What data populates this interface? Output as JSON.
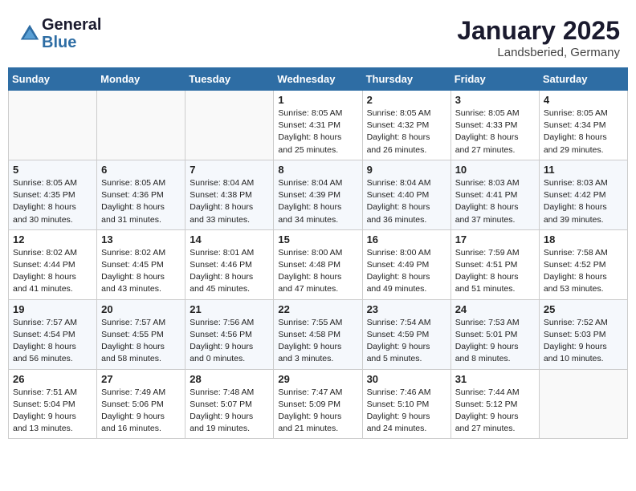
{
  "header": {
    "logo_line1": "General",
    "logo_line2": "Blue",
    "month_title": "January 2025",
    "location": "Landsberied, Germany"
  },
  "weekdays": [
    "Sunday",
    "Monday",
    "Tuesday",
    "Wednesday",
    "Thursday",
    "Friday",
    "Saturday"
  ],
  "weeks": [
    [
      {
        "day": "",
        "info": ""
      },
      {
        "day": "",
        "info": ""
      },
      {
        "day": "",
        "info": ""
      },
      {
        "day": "1",
        "info": "Sunrise: 8:05 AM\nSunset: 4:31 PM\nDaylight: 8 hours\nand 25 minutes."
      },
      {
        "day": "2",
        "info": "Sunrise: 8:05 AM\nSunset: 4:32 PM\nDaylight: 8 hours\nand 26 minutes."
      },
      {
        "day": "3",
        "info": "Sunrise: 8:05 AM\nSunset: 4:33 PM\nDaylight: 8 hours\nand 27 minutes."
      },
      {
        "day": "4",
        "info": "Sunrise: 8:05 AM\nSunset: 4:34 PM\nDaylight: 8 hours\nand 29 minutes."
      }
    ],
    [
      {
        "day": "5",
        "info": "Sunrise: 8:05 AM\nSunset: 4:35 PM\nDaylight: 8 hours\nand 30 minutes."
      },
      {
        "day": "6",
        "info": "Sunrise: 8:05 AM\nSunset: 4:36 PM\nDaylight: 8 hours\nand 31 minutes."
      },
      {
        "day": "7",
        "info": "Sunrise: 8:04 AM\nSunset: 4:38 PM\nDaylight: 8 hours\nand 33 minutes."
      },
      {
        "day": "8",
        "info": "Sunrise: 8:04 AM\nSunset: 4:39 PM\nDaylight: 8 hours\nand 34 minutes."
      },
      {
        "day": "9",
        "info": "Sunrise: 8:04 AM\nSunset: 4:40 PM\nDaylight: 8 hours\nand 36 minutes."
      },
      {
        "day": "10",
        "info": "Sunrise: 8:03 AM\nSunset: 4:41 PM\nDaylight: 8 hours\nand 37 minutes."
      },
      {
        "day": "11",
        "info": "Sunrise: 8:03 AM\nSunset: 4:42 PM\nDaylight: 8 hours\nand 39 minutes."
      }
    ],
    [
      {
        "day": "12",
        "info": "Sunrise: 8:02 AM\nSunset: 4:44 PM\nDaylight: 8 hours\nand 41 minutes."
      },
      {
        "day": "13",
        "info": "Sunrise: 8:02 AM\nSunset: 4:45 PM\nDaylight: 8 hours\nand 43 minutes."
      },
      {
        "day": "14",
        "info": "Sunrise: 8:01 AM\nSunset: 4:46 PM\nDaylight: 8 hours\nand 45 minutes."
      },
      {
        "day": "15",
        "info": "Sunrise: 8:00 AM\nSunset: 4:48 PM\nDaylight: 8 hours\nand 47 minutes."
      },
      {
        "day": "16",
        "info": "Sunrise: 8:00 AM\nSunset: 4:49 PM\nDaylight: 8 hours\nand 49 minutes."
      },
      {
        "day": "17",
        "info": "Sunrise: 7:59 AM\nSunset: 4:51 PM\nDaylight: 8 hours\nand 51 minutes."
      },
      {
        "day": "18",
        "info": "Sunrise: 7:58 AM\nSunset: 4:52 PM\nDaylight: 8 hours\nand 53 minutes."
      }
    ],
    [
      {
        "day": "19",
        "info": "Sunrise: 7:57 AM\nSunset: 4:54 PM\nDaylight: 8 hours\nand 56 minutes."
      },
      {
        "day": "20",
        "info": "Sunrise: 7:57 AM\nSunset: 4:55 PM\nDaylight: 8 hours\nand 58 minutes."
      },
      {
        "day": "21",
        "info": "Sunrise: 7:56 AM\nSunset: 4:56 PM\nDaylight: 9 hours\nand 0 minutes."
      },
      {
        "day": "22",
        "info": "Sunrise: 7:55 AM\nSunset: 4:58 PM\nDaylight: 9 hours\nand 3 minutes."
      },
      {
        "day": "23",
        "info": "Sunrise: 7:54 AM\nSunset: 4:59 PM\nDaylight: 9 hours\nand 5 minutes."
      },
      {
        "day": "24",
        "info": "Sunrise: 7:53 AM\nSunset: 5:01 PM\nDaylight: 9 hours\nand 8 minutes."
      },
      {
        "day": "25",
        "info": "Sunrise: 7:52 AM\nSunset: 5:03 PM\nDaylight: 9 hours\nand 10 minutes."
      }
    ],
    [
      {
        "day": "26",
        "info": "Sunrise: 7:51 AM\nSunset: 5:04 PM\nDaylight: 9 hours\nand 13 minutes."
      },
      {
        "day": "27",
        "info": "Sunrise: 7:49 AM\nSunset: 5:06 PM\nDaylight: 9 hours\nand 16 minutes."
      },
      {
        "day": "28",
        "info": "Sunrise: 7:48 AM\nSunset: 5:07 PM\nDaylight: 9 hours\nand 19 minutes."
      },
      {
        "day": "29",
        "info": "Sunrise: 7:47 AM\nSunset: 5:09 PM\nDaylight: 9 hours\nand 21 minutes."
      },
      {
        "day": "30",
        "info": "Sunrise: 7:46 AM\nSunset: 5:10 PM\nDaylight: 9 hours\nand 24 minutes."
      },
      {
        "day": "31",
        "info": "Sunrise: 7:44 AM\nSunset: 5:12 PM\nDaylight: 9 hours\nand 27 minutes."
      },
      {
        "day": "",
        "info": ""
      }
    ]
  ]
}
